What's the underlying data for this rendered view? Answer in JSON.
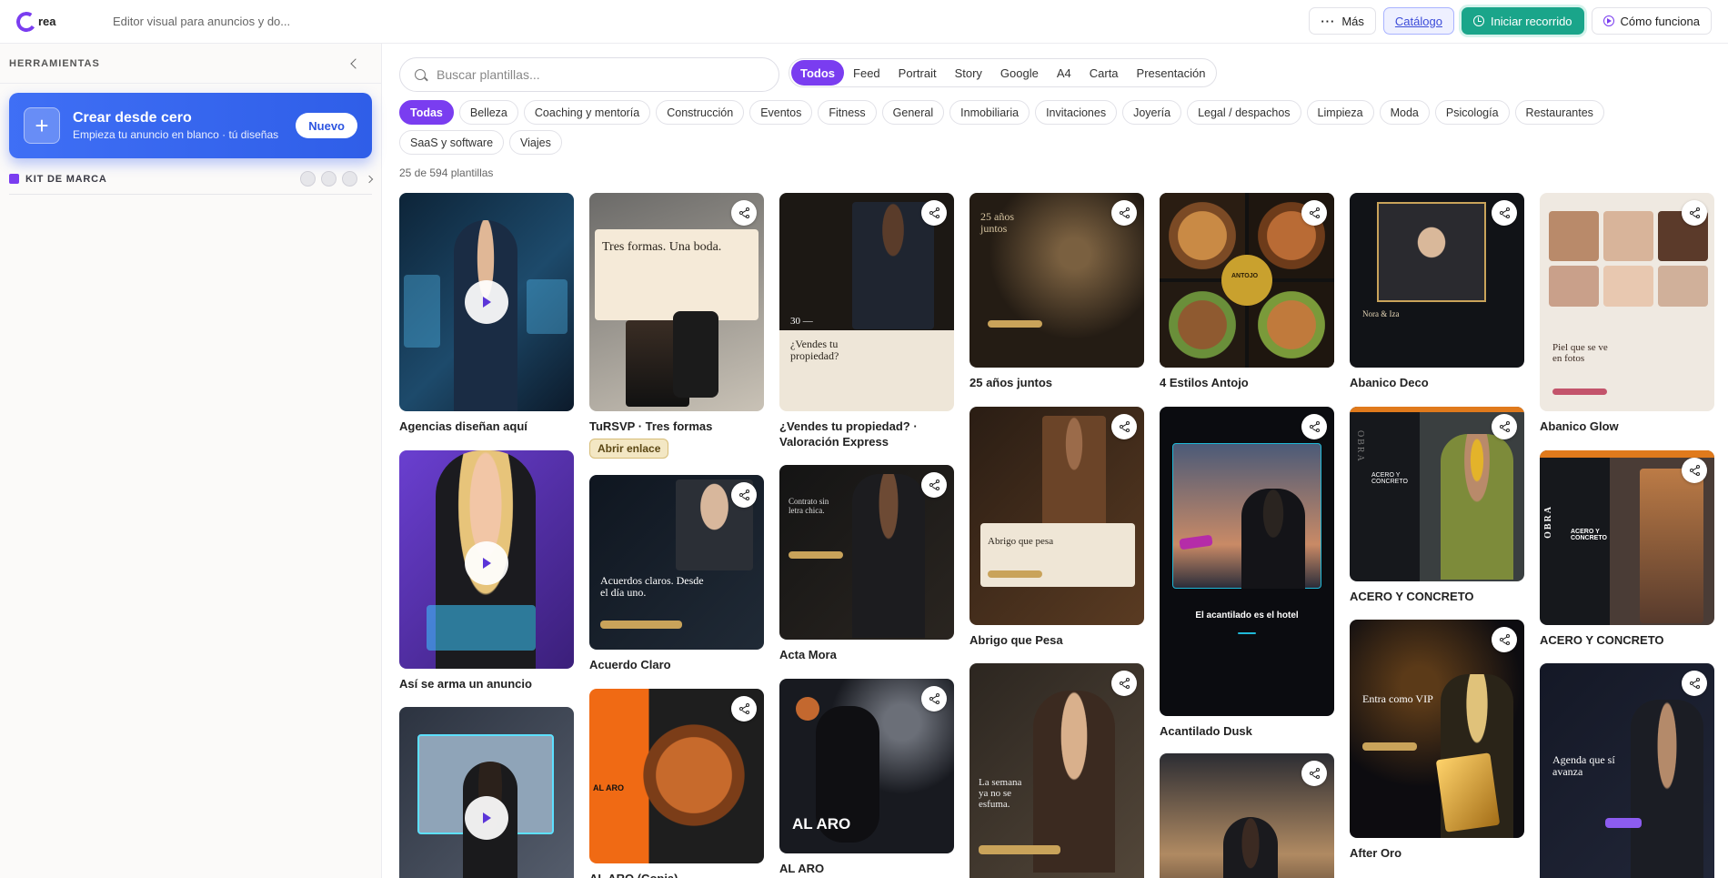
{
  "header": {
    "logo_text": "rea",
    "subtitle": "Editor visual para anuncios y do...",
    "more_label": "Más",
    "catalog_label": "Catálogo",
    "start_tour_label": "Iniciar recorrido",
    "how_label": "Cómo funciona"
  },
  "sidebar": {
    "title": "HERRAMIENTAS",
    "create_title": "Crear desde cero",
    "create_subtitle": "Empieza tu anuncio en blanco · tú diseñas",
    "new_label": "Nuevo",
    "kit_label": "KIT DE MARCA"
  },
  "search": {
    "placeholder": "Buscar plantillas..."
  },
  "formats": [
    "Todos",
    "Feed",
    "Portrait",
    "Story",
    "Google",
    "A4",
    "Carta",
    "Presentación"
  ],
  "categories": [
    "Todas",
    "Belleza",
    "Coaching y mentoría",
    "Construcción",
    "Eventos",
    "Fitness",
    "General",
    "Inmobiliaria",
    "Invitaciones",
    "Joyería",
    "Legal / despachos",
    "Limpieza",
    "Moda",
    "Psicología",
    "Restaurantes",
    "SaaS y software",
    "Viajes"
  ],
  "results_count": "25 de 594 plantillas",
  "templates": {
    "agencias": {
      "title": "Agencias diseñan aquí"
    },
    "turvsp": {
      "title": "TuRSVP · Tres formas",
      "badge": "Abrir enlace",
      "thumb_text": "Tres formas. Una boda."
    },
    "vendes": {
      "title": "¿Vendes tu propiedad? · Valoración Express",
      "thumb_text": "¿Vendes tu propiedad?",
      "thumb_num": "30 —"
    },
    "anos": {
      "title": "25 años juntos",
      "thumb_text": "25 años juntos"
    },
    "antojo": {
      "title": "4 Estilos Antojo",
      "thumb_text": "ANTOJO"
    },
    "deco": {
      "title": "Abanico Deco",
      "thumb_text": "Nora & Iza"
    },
    "glow": {
      "title": "Abanico Glow",
      "thumb_text": "Piel que se ve en fotos"
    },
    "arma": {
      "title": "Así se arma un anuncio"
    },
    "acuerdo": {
      "title": "Acuerdo Claro",
      "thumb_text": "Acuerdos claros. Desde el día uno."
    },
    "acta": {
      "title": "Acta Mora",
      "thumb_text": "Contrato sin letra chica."
    },
    "abrigo": {
      "title": "Abrigo que Pesa",
      "thumb_text": "Abrigo que pesa"
    },
    "dusk": {
      "title": "Acantilado Dusk",
      "thumb_text": "El acantilado es el hotel"
    },
    "acero1": {
      "title": "ACERO Y CONCRETO",
      "thumb_text": "ACERO Y CONCRETO",
      "thumb_side": "OBRA"
    },
    "acero2": {
      "title": "ACERO Y CONCRETO",
      "thumb_text": "ACERO Y CONCRETO",
      "thumb_side": "OBRA"
    },
    "oro": {
      "title": "After Oro",
      "thumb_text": "Entra como VIP"
    },
    "aro": {
      "title": "AL ARO",
      "thumb_text": "AL ARO"
    },
    "aro_copia": {
      "title": "AL ARO (Copia)",
      "thumb_text": "AL ARO"
    },
    "semana": {
      "thumb_text": "La semana ya no se esfuma."
    },
    "agenda": {
      "thumb_text": "Agenda que sí avanza"
    }
  },
  "colors": {
    "accent": "#7a3df0",
    "primary_blue": "#3160ec",
    "teal": "#1aa58a"
  }
}
